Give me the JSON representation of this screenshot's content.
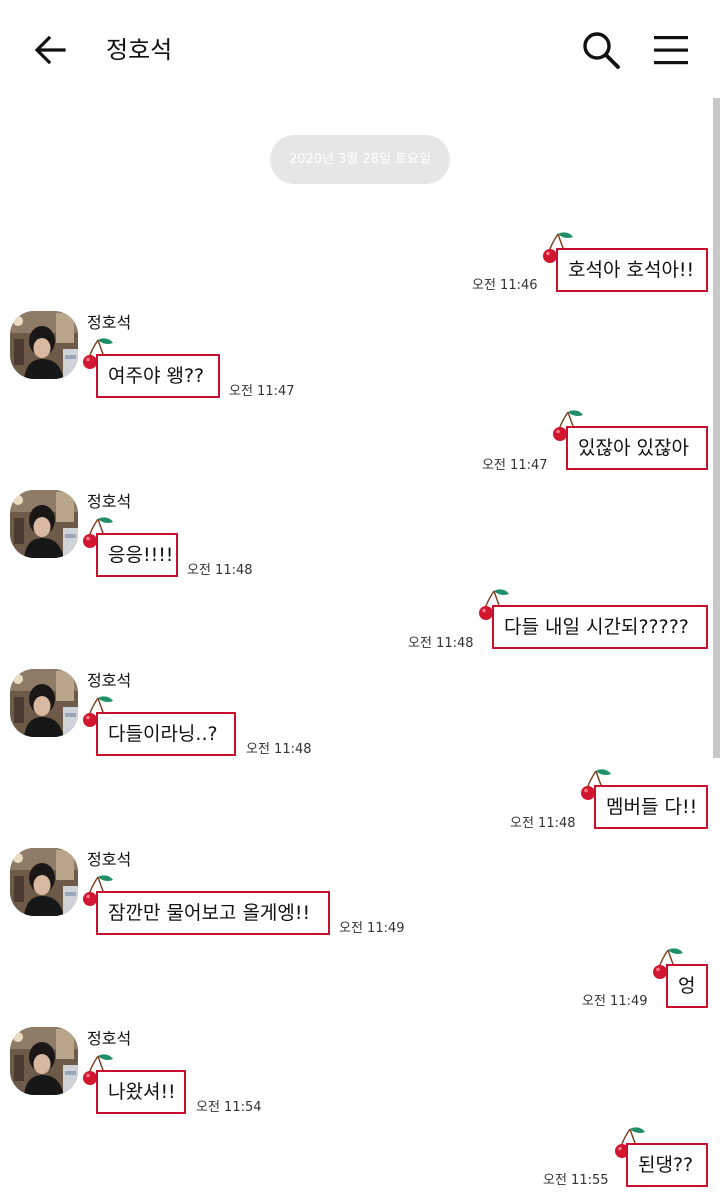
{
  "header": {
    "title": "정호석",
    "back_icon": "arrow-left-icon",
    "search_icon": "search-icon",
    "menu_icon": "hamburger-menu-icon"
  },
  "date_divider": "2020년 3월 28일 토요일",
  "colors": {
    "bubble_border": "#c8102e",
    "cherry_red": "#d0172f",
    "leaf_green": "#1f8f6a",
    "date_pill": "#e6e6e6"
  },
  "contact": {
    "name": "정호석"
  },
  "messages": [
    {
      "side": "out",
      "text": "호석아 호석아!!",
      "time": "오전 11:46"
    },
    {
      "side": "in",
      "sender": "정호석",
      "text": "여주야 왱??",
      "time": "오전 11:47"
    },
    {
      "side": "out",
      "text": "있잖아 있잖아",
      "time": "오전 11:47"
    },
    {
      "side": "in",
      "sender": "정호석",
      "text": "응응!!!!",
      "time": "오전 11:48"
    },
    {
      "side": "out",
      "text": "다들 내일 시간되?????",
      "time": "오전 11:48"
    },
    {
      "side": "in",
      "sender": "정호석",
      "text": "다들이라닝..?",
      "time": "오전 11:48"
    },
    {
      "side": "out",
      "text": "멤버들 다!!",
      "time": "오전 11:48"
    },
    {
      "side": "in",
      "sender": "정호석",
      "text": "잠깐만 물어보고 올게엥!!",
      "time": "오전 11:49"
    },
    {
      "side": "out",
      "text": "엉",
      "time": "오전 11:49"
    },
    {
      "side": "in",
      "sender": "정호석",
      "text": "나왔셔!!",
      "time": "오전 11:54"
    },
    {
      "side": "out",
      "text": "된댕??",
      "time": "오전 11:55"
    }
  ]
}
